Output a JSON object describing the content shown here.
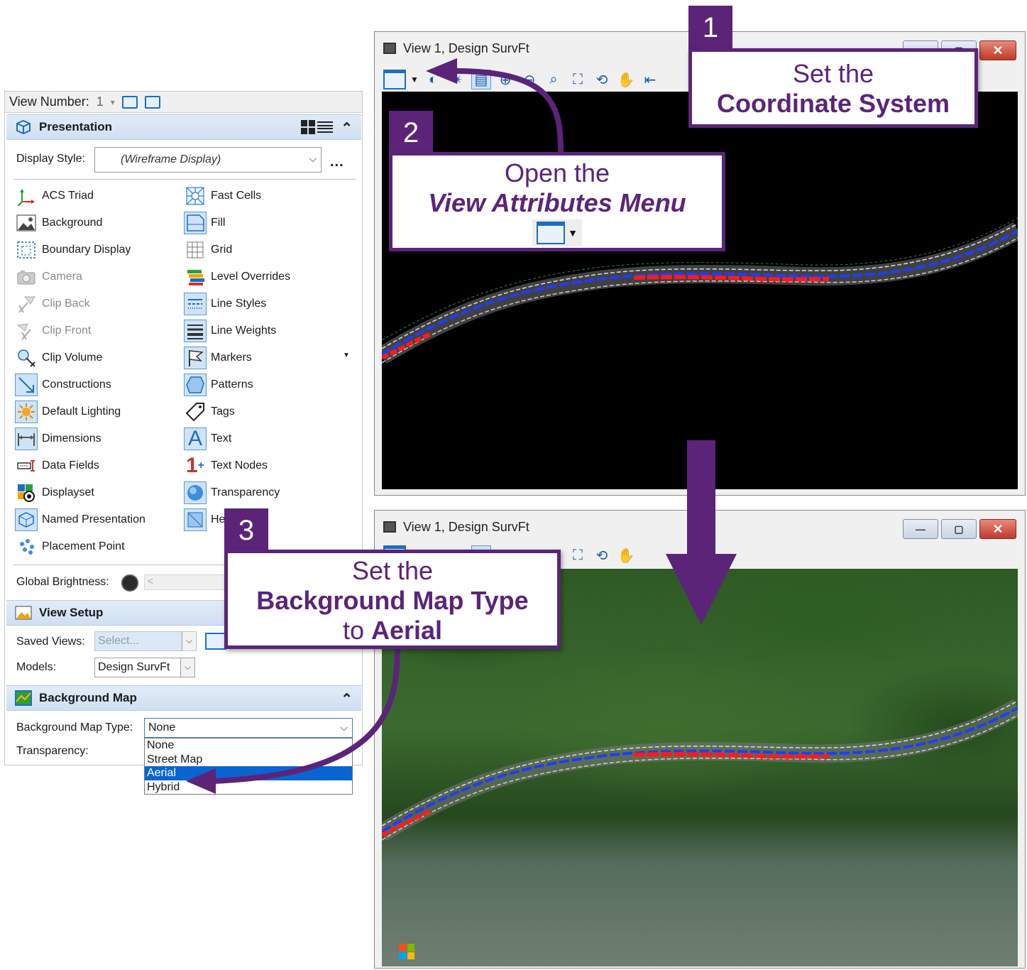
{
  "attributes_panel": {
    "view_number_label": "View Number:",
    "view_number_value": "1",
    "presentation": {
      "title": "Presentation",
      "display_style_label": "Display Style:",
      "display_style_value": "(Wireframe Display)",
      "more_button": "...",
      "items_left": [
        {
          "label": "ACS Triad",
          "icon": "acs-triad-icon",
          "enabled": true,
          "active": false
        },
        {
          "label": "Background",
          "icon": "background-icon",
          "enabled": true,
          "active": false
        },
        {
          "label": "Boundary Display",
          "icon": "boundary-display-icon",
          "enabled": true,
          "active": false
        },
        {
          "label": "Camera",
          "icon": "camera-icon",
          "enabled": false,
          "active": false
        },
        {
          "label": "Clip Back",
          "icon": "clip-back-icon",
          "enabled": false,
          "active": false
        },
        {
          "label": "Clip Front",
          "icon": "clip-front-icon",
          "enabled": false,
          "active": false
        },
        {
          "label": "Clip Volume",
          "icon": "clip-volume-icon",
          "enabled": true,
          "active": false
        },
        {
          "label": "Constructions",
          "icon": "constructions-icon",
          "enabled": true,
          "active": true
        },
        {
          "label": "Default Lighting",
          "icon": "default-lighting-icon",
          "enabled": true,
          "active": true
        },
        {
          "label": "Dimensions",
          "icon": "dimensions-icon",
          "enabled": true,
          "active": true
        },
        {
          "label": "Data Fields",
          "icon": "data-fields-icon",
          "enabled": true,
          "active": false
        },
        {
          "label": "Displayset",
          "icon": "displayset-icon",
          "enabled": true,
          "active": false
        },
        {
          "label": "Named Presentation",
          "icon": "named-presentation-icon",
          "enabled": true,
          "active": true
        },
        {
          "label": "Placement Point",
          "icon": "placement-point-icon",
          "enabled": true,
          "active": false
        }
      ],
      "items_right": [
        {
          "label": "Fast Cells",
          "icon": "fast-cells-icon",
          "enabled": true,
          "active": false
        },
        {
          "label": "Fill",
          "icon": "fill-icon",
          "enabled": true,
          "active": true
        },
        {
          "label": "Grid",
          "icon": "grid-icon",
          "enabled": true,
          "active": false
        },
        {
          "label": "Level Overrides",
          "icon": "level-overrides-icon",
          "enabled": true,
          "active": false
        },
        {
          "label": "Line Styles",
          "icon": "line-styles-icon",
          "enabled": true,
          "active": true
        },
        {
          "label": "Line Weights",
          "icon": "line-weights-icon",
          "enabled": true,
          "active": true
        },
        {
          "label": "Markers",
          "icon": "markers-icon",
          "enabled": true,
          "active": true
        },
        {
          "label": "Patterns",
          "icon": "patterns-icon",
          "enabled": true,
          "active": true
        },
        {
          "label": "Tags",
          "icon": "tags-icon",
          "enabled": true,
          "active": false
        },
        {
          "label": "Text",
          "icon": "text-icon",
          "enabled": true,
          "active": true
        },
        {
          "label": "Text Nodes",
          "icon": "text-nodes-icon",
          "enabled": true,
          "active": false
        },
        {
          "label": "Transparency",
          "icon": "transparency-icon",
          "enabled": true,
          "active": true
        },
        {
          "label": "He",
          "icon": "hidden-line-icon",
          "enabled": true,
          "active": true
        }
      ],
      "global_brightness_label": "Global Brightness:",
      "global_brightness_arrow": "<"
    },
    "view_setup": {
      "title": "View Setup",
      "saved_views_label": "Saved Views:",
      "saved_views_value": "Select...",
      "models_label": "Models:",
      "models_value": "Design SurvFt"
    },
    "background_map": {
      "title": "Background Map",
      "type_label": "Background Map Type:",
      "type_value": "None",
      "transparency_label": "Transparency:",
      "options": [
        "None",
        "Street Map",
        "Aerial",
        "Hybrid"
      ],
      "highlighted_option": "Aerial"
    }
  },
  "view_window_top": {
    "title": "View 1, Design SurvFt"
  },
  "view_window_bottom": {
    "title": "View 1, Design SurvFt",
    "attribution": "Microsoft"
  },
  "callouts": {
    "step1": {
      "number": "1",
      "line1": "Set the",
      "line2": "Coordinate System"
    },
    "step2": {
      "number": "2",
      "line1": "Open the",
      "line2": "View Attributes Menu"
    },
    "step3": {
      "number": "3",
      "line1": "Set the",
      "line2": "Background Map Type",
      "line3_prefix": "to ",
      "line3_bold": "Aerial"
    }
  },
  "colors": {
    "callout_purple": "#5b2479",
    "road_blue": "#1f3cff",
    "road_red": "#ff1a1a",
    "selection_blue": "#0a64d2"
  }
}
